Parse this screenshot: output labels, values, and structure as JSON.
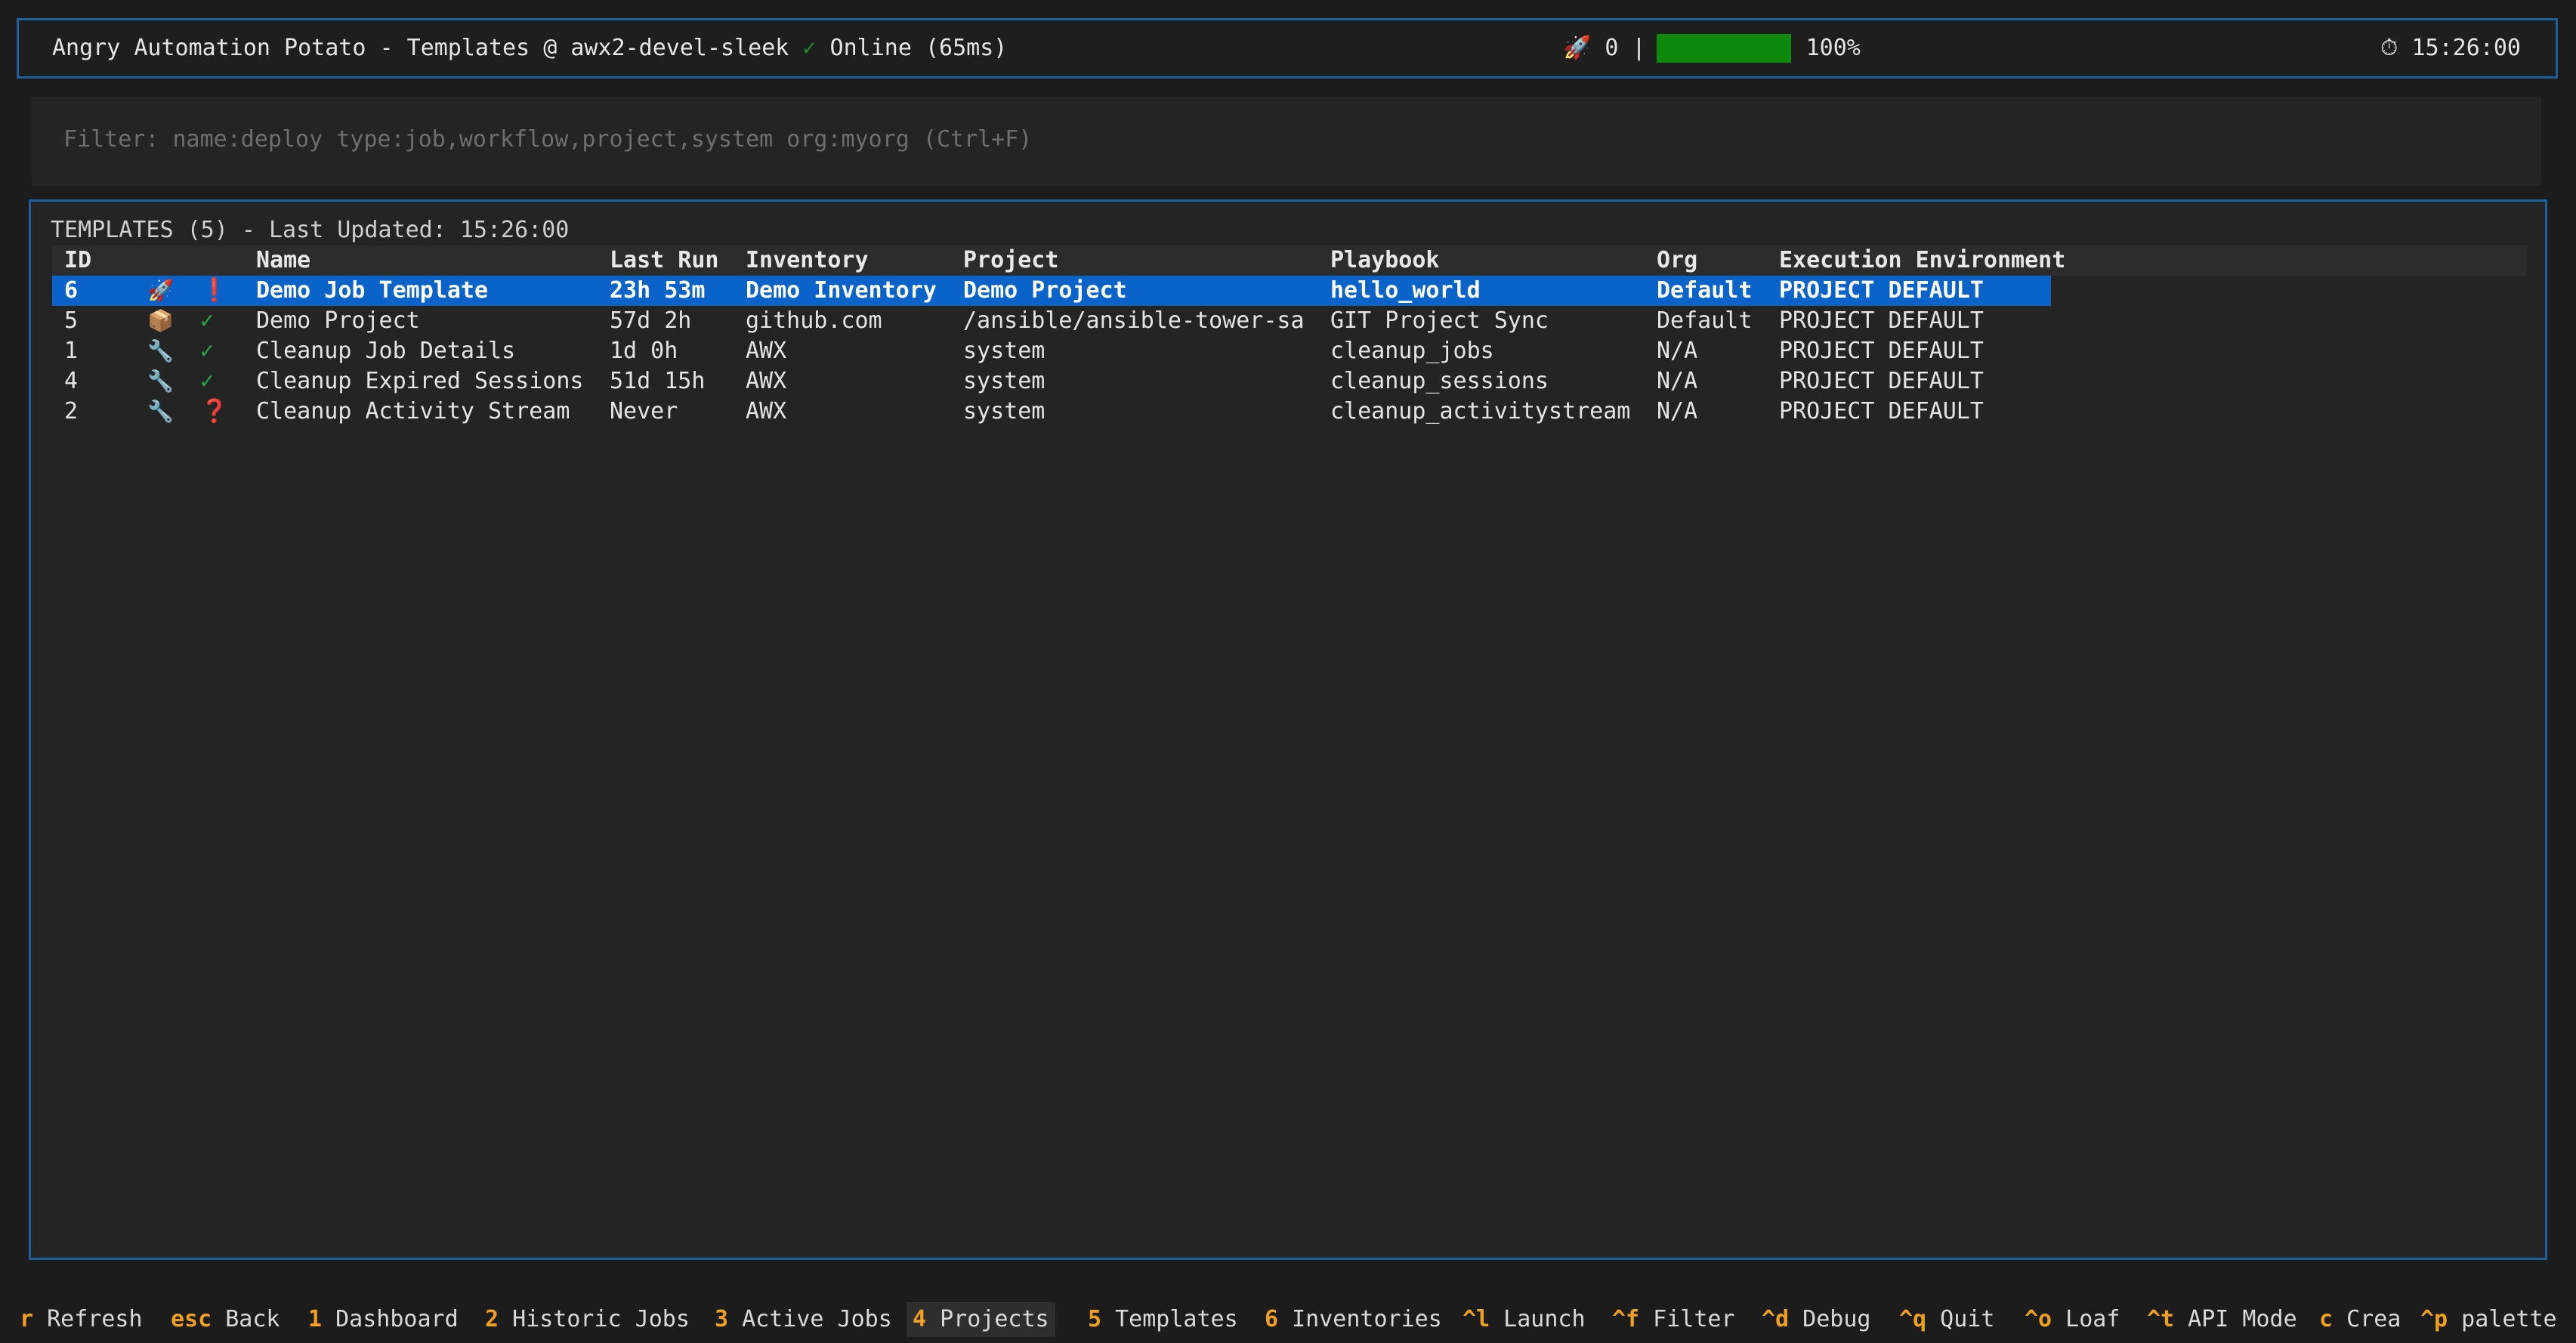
{
  "header": {
    "title": "Angry Automation Potato - Templates @ awx2-devel-sleek ",
    "check_glyph": "✓",
    "status": " Online (65ms)",
    "rocket_icon": "🚀",
    "active_count": " 0 |",
    "progress_percent": 100,
    "progress_label": "100%",
    "clock_icon": "⏱",
    "time": " 15:26:00"
  },
  "filter": {
    "placeholder": "Filter: name:deploy type:job,workflow,project,system org:myorg (Ctrl+F)",
    "value": ""
  },
  "templates": {
    "title": "TEMPLATES (5) - Last Updated: 15:26:00",
    "columns": {
      "id": "ID",
      "name": "Name",
      "last_run": "Last Run",
      "inventory": "Inventory",
      "project": "Project",
      "playbook": "Playbook",
      "org": "Org",
      "ee": "Execution Environment"
    },
    "rows": [
      {
        "id": "6",
        "icon": "🚀",
        "status": "❗",
        "name": "Demo Job Template",
        "last_run": "23h 53m",
        "inventory": "Demo Inventory",
        "project": "Demo Project",
        "playbook": "hello_world",
        "org": "Default",
        "ee": "PROJECT DEFAULT"
      },
      {
        "id": "5",
        "icon": "📦",
        "status": "✓",
        "name": "Demo Project",
        "last_run": "57d 2h",
        "inventory": "github.com",
        "project": "/ansible/ansible-tower-sa",
        "playbook": "GIT Project Sync",
        "org": "Default",
        "ee": "PROJECT DEFAULT"
      },
      {
        "id": "1",
        "icon": "🔧",
        "status": "✓",
        "name": "Cleanup Job Details",
        "last_run": "1d 0h",
        "inventory": "AWX",
        "project": "system",
        "playbook": "cleanup_jobs",
        "org": "N/A",
        "ee": "PROJECT DEFAULT"
      },
      {
        "id": "4",
        "icon": "🔧",
        "status": "✓",
        "name": "Cleanup Expired Sessions",
        "last_run": "51d 15h",
        "inventory": "AWX",
        "project": "system",
        "playbook": "cleanup_sessions",
        "org": "N/A",
        "ee": "PROJECT DEFAULT"
      },
      {
        "id": "2",
        "icon": "🔧",
        "status": "❓",
        "name": "Cleanup Activity Stream",
        "last_run": "Never",
        "inventory": "AWX",
        "project": "system",
        "playbook": "cleanup_activitystream",
        "org": "N/A",
        "ee": "PROJECT DEFAULT"
      }
    ]
  },
  "footer": {
    "items": [
      {
        "key": "r",
        "label": " Refresh"
      },
      {
        "key": "esc",
        "label": " Back"
      },
      {
        "key": "1",
        "label": " Dashboard"
      },
      {
        "key": "2",
        "label": " Historic Jobs"
      },
      {
        "key": "3",
        "label": " Active Jobs"
      },
      {
        "key": "4",
        "label": " Projects"
      },
      {
        "key": "5",
        "label": " Templates"
      },
      {
        "key": "6",
        "label": " Inventories"
      },
      {
        "key": "^l",
        "label": " Launch"
      },
      {
        "key": "^f",
        "label": " Filter"
      },
      {
        "key": "^d",
        "label": " Debug"
      },
      {
        "key": "^q",
        "label": " Quit"
      },
      {
        "key": "^o",
        "label": " Loaf"
      },
      {
        "key": "^t",
        "label": " API Mode"
      },
      {
        "key": "c",
        "label": " Crea"
      },
      {
        "key": "^p",
        "label": " palette"
      }
    ]
  },
  "colors": {
    "border_accent": "#1f5f9e",
    "selection": "#0a63c9",
    "progress": "#0d8a0d",
    "key_accent": "#f0a020",
    "ok": "#28a745",
    "error": "#e5262c"
  }
}
